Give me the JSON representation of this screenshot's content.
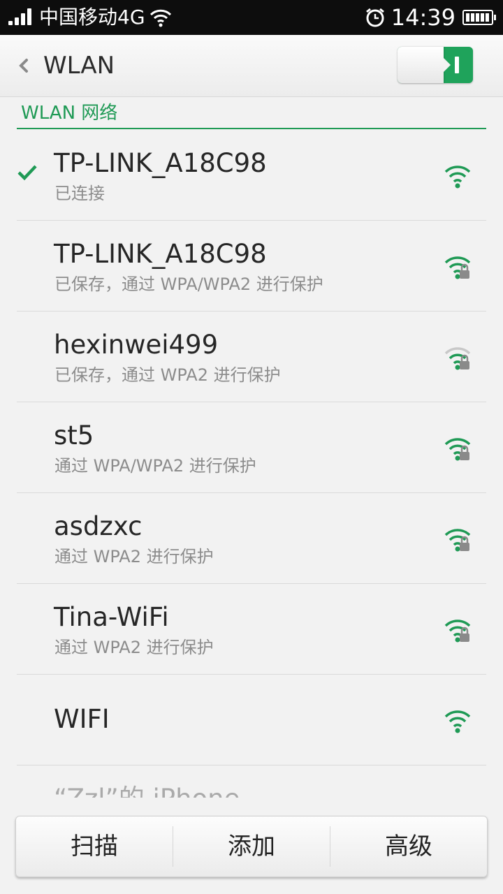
{
  "status_bar": {
    "carrier": "中国移动4G",
    "time": "14:39",
    "icons": [
      "signal-icon",
      "wifi-icon",
      "alarm-icon",
      "battery-icon"
    ]
  },
  "header": {
    "title": "WLAN",
    "back_icon": "chevron-left-icon",
    "wlan_toggle": "on"
  },
  "section": {
    "title": "WLAN 网络"
  },
  "networks": [
    {
      "ssid": "TP-LINK_A18C98",
      "status": "已连接",
      "connected": true,
      "secured": false,
      "signal": "strong"
    },
    {
      "ssid": "TP-LINK_A18C98",
      "status": "已保存，通过 WPA/WPA2 进行保护",
      "connected": false,
      "secured": true,
      "signal": "strong"
    },
    {
      "ssid": "hexinwei499",
      "status": "已保存，通过 WPA2 进行保护",
      "connected": false,
      "secured": true,
      "signal": "weak"
    },
    {
      "ssid": "st5",
      "status": "通过 WPA/WPA2 进行保护",
      "connected": false,
      "secured": true,
      "signal": "strong"
    },
    {
      "ssid": "asdzxc",
      "status": "通过 WPA2 进行保护",
      "connected": false,
      "secured": true,
      "signal": "strong"
    },
    {
      "ssid": "Tina-WiFi",
      "status": "通过 WPA2 进行保护",
      "connected": false,
      "secured": true,
      "signal": "strong"
    },
    {
      "ssid": "WIFI",
      "status": "",
      "connected": false,
      "secured": false,
      "signal": "strong"
    },
    {
      "ssid": "“Zzl”的 iPhone",
      "status": "",
      "connected": false,
      "secured": true,
      "signal": "strong"
    }
  ],
  "bottom_bar": {
    "scan_label": "扫描",
    "add_label": "添加",
    "advanced_label": "高级"
  },
  "colors": {
    "accent": "#1f9a55",
    "status_bar_bg": "#0d0d0d",
    "background": "#f2f2f2"
  }
}
